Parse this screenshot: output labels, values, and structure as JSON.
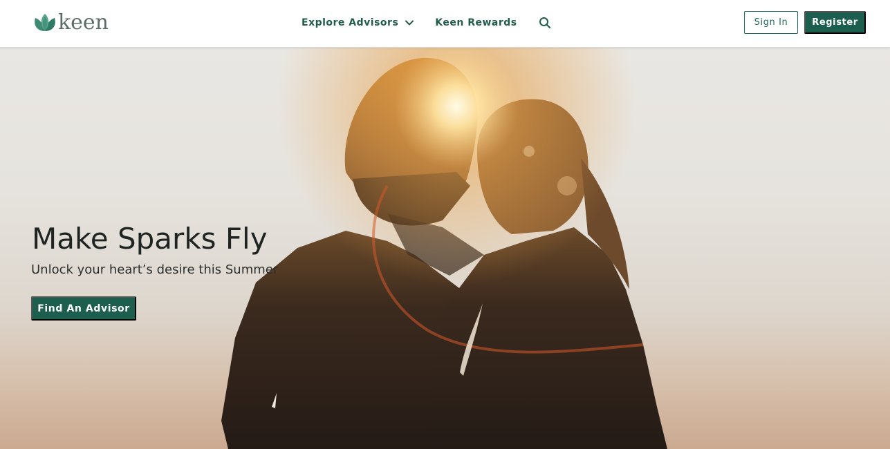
{
  "header": {
    "logo_text": "keen",
    "nav": {
      "explore_label": "Explore Advisors",
      "rewards_label": "Keen Rewards"
    },
    "signin_label": "Sign In",
    "register_label": "Register"
  },
  "hero": {
    "title": "Make Sparks Fly",
    "subtitle": "Unlock your heart’s desire this Summer",
    "cta_label": "Find An Advisor"
  },
  "icons": {
    "logo": "leaf-logo-icon",
    "chevron": "chevron-down-icon",
    "search": "search-icon"
  },
  "colors": {
    "brand_green": "#1c5f4e",
    "nav_text": "#1f5c4c",
    "logo_leaf": "#3f8a74"
  }
}
